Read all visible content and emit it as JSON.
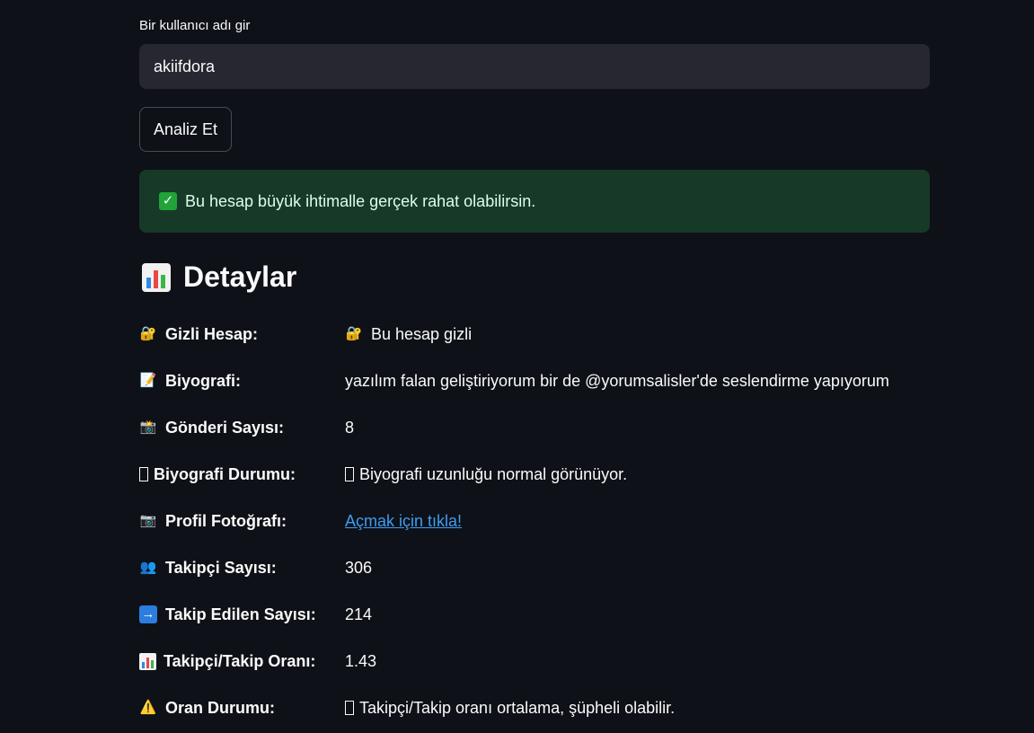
{
  "form": {
    "label": "Bir kullanıcı adı gir",
    "username_value": "akiifdora",
    "submit_label": "Analiz Et"
  },
  "alert": {
    "text": "Bu hesap büyük ihtimalle gerçek rahat olabilirsin.",
    "icon": "check-mark-icon",
    "color": "#173928"
  },
  "details": {
    "title": "Detaylar",
    "rows": [
      {
        "label": "Gizli Hesap:",
        "value": "Bu hesap gizli",
        "icon": "lock-icon"
      },
      {
        "label": "Biyografi:",
        "value": "yazılım falan geliştiriyorum bir de @yorumsalisler'de seslendirme yapıyorum",
        "icon": "memo-icon"
      },
      {
        "label": "Gönderi Sayısı:",
        "value": "8",
        "icon": "camera-flash-icon"
      },
      {
        "label": "Biyografi Durumu:",
        "value": "Biyografi uzunluğu normal görünüyor.",
        "icon": "missing-glyph-icon"
      },
      {
        "label": "Profil Fotoğrafı:",
        "value": "Açmak için tıkla!",
        "icon": "camera-icon"
      },
      {
        "label": "Takipçi Sayısı:",
        "value": "306",
        "icon": "people-icon"
      },
      {
        "label": "Takip Edilen Sayısı:",
        "value": "214",
        "icon": "arrow-right-icon"
      },
      {
        "label": "Takipçi/Takip Oranı:",
        "value": "1.43",
        "icon": "bar-chart-icon"
      },
      {
        "label": "Oran Durumu:",
        "value": "Takipçi/Takip oranı ortalama, şüpheli olabilir.",
        "icon": "warning-icon"
      }
    ]
  },
  "colors": {
    "background": "#0e1117",
    "input_bg": "#262730",
    "link": "#3d9df3"
  }
}
